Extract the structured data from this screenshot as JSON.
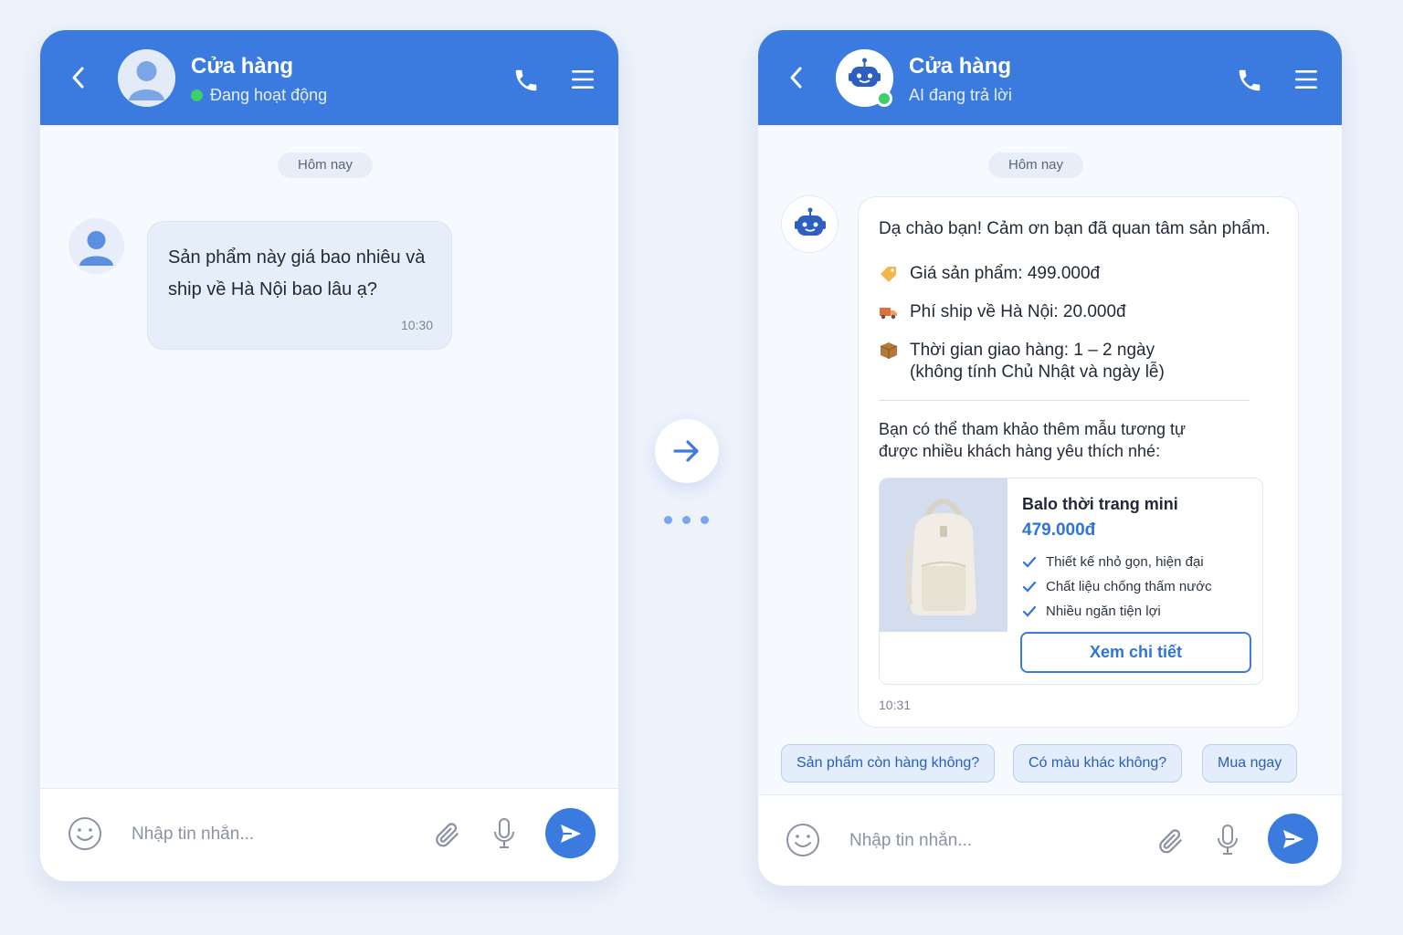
{
  "left": {
    "header": {
      "title": "Cửa hàng",
      "status": "Đang hoạt động"
    },
    "day_label": "Hôm nay",
    "message": {
      "text": "Sản phẩm này giá bao nhiêu và ship về Hà Nội bao lâu ạ?",
      "time": "10:30"
    },
    "composer": {
      "placeholder": "Nhập tin nhắn..."
    }
  },
  "right": {
    "header": {
      "title": "Cửa hàng",
      "status": "AI đang trả lời"
    },
    "day_label": "Hôm nay",
    "reply": {
      "greeting": "Dạ chào bạn! Cảm ơn bạn đã quan tâm sản phẩm.",
      "info": [
        {
          "icon": "price-tag-icon",
          "text": "Giá sản phẩm: 499.000đ"
        },
        {
          "icon": "delivery-truck-icon",
          "text": "Phí ship về Hà Nội: 20.000đ"
        },
        {
          "icon": "package-box-icon",
          "text": "Thời gian giao hàng: 1 – 2 ngày (không tính Chủ Nhật và ngày lễ)"
        }
      ],
      "suggest_text": "Bạn có thể tham khảo thêm mẫu tương tự được nhiều khách hàng yêu thích nhé:",
      "product": {
        "name": "Balo thời trang mini",
        "price": "479.000đ",
        "features": [
          "Thiết kế nhỏ gọn, hiện đại",
          "Chất liệu chống thấm nước",
          "Nhiều ngăn tiện lợi"
        ],
        "button": "Xem chi tiết"
      },
      "time": "10:31"
    },
    "quick_replies": [
      "Sản phẩm còn hàng không?",
      "Có màu khác không?",
      "Mua ngay"
    ],
    "composer": {
      "placeholder": "Nhập tin nhắn..."
    }
  },
  "colors": {
    "accent": "#3b7be0",
    "online": "#3ecf6a",
    "background": "#eef3fb"
  }
}
